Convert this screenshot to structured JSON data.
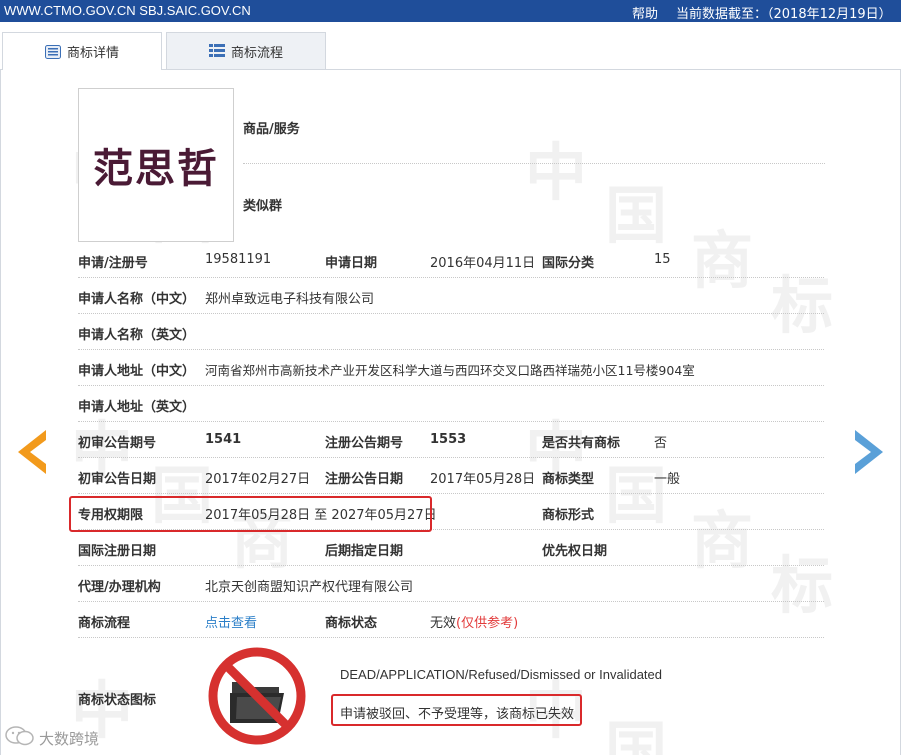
{
  "header": {
    "sites": "WWW.CTMO.GOV.CN SBJ.SAIC.GOV.CN",
    "help": "帮助",
    "data_date": "当前数据截至：（2018年12月19日）"
  },
  "tabs": [
    {
      "label": "商标详情",
      "icon": "list-detail-icon",
      "active": true
    },
    {
      "label": "商标流程",
      "icon": "list-grid-icon",
      "active": false
    }
  ],
  "watermark": {
    "chars": [
      "中",
      "国",
      "商",
      "标"
    ]
  },
  "trademark": {
    "image_text": "范思哲",
    "goods_services_label": "商品/服务",
    "similar_group_label": "类似群"
  },
  "fields": {
    "reg_no_label": "申请/注册号",
    "reg_no": "19581191",
    "app_date_label": "申请日期",
    "app_date": "2016年04月11日",
    "intl_class_label": "国际分类",
    "intl_class": "15",
    "applicant_cn_label": "申请人名称（中文）",
    "applicant_cn": "郑州卓致远电子科技有限公司",
    "applicant_en_label": "申请人名称（英文）",
    "applicant_en": "",
    "address_cn_label": "申请人地址（中文）",
    "address_cn": "河南省郑州市高新技术产业开发区科学大道与西四环交叉口路西祥瑞苑小区11号楼904室",
    "address_en_label": "申请人地址（英文）",
    "address_en": "",
    "prelim_issue_label": "初审公告期号",
    "prelim_issue": "1541",
    "reg_issue_label": "注册公告期号",
    "reg_issue": "1553",
    "shared_label": "是否共有商标",
    "shared": "否",
    "prelim_date_label": "初审公告日期",
    "prelim_date": "2017年02月27日",
    "reg_date_label": "注册公告日期",
    "reg_date": "2017年05月28日",
    "tm_type_label": "商标类型",
    "tm_type": "一般",
    "exclusive_label": "专用权期限",
    "exclusive": "2017年05月28日 至 2027年05月27日",
    "tm_form_label": "商标形式",
    "tm_form": "",
    "intl_reg_date_label": "国际注册日期",
    "intl_reg_date": "",
    "later_date_label": "后期指定日期",
    "later_date": "",
    "priority_date_label": "优先权日期",
    "priority_date": "",
    "agency_label": "代理/办理机构",
    "agency": "北京天创商盟知识产权代理有限公司",
    "process_label": "商标流程",
    "process_link": "点击查看",
    "status_label": "商标状态",
    "status": "无效",
    "status_note": "(仅供参考)",
    "status_icon_label": "商标状态图标"
  },
  "status_icon": {
    "icon": "no-folder-icon",
    "en": "DEAD/APPLICATION/Refused/Dismissed or Invalidated",
    "cn": "申请被驳回、不予受理等，该商标已失效"
  },
  "footer_watermark": "大数跨境",
  "colors": {
    "topbar": "#1f4e9a",
    "accent_red": "#d9292b",
    "link": "#2b7fc8",
    "arrow_left": "#f29a1c",
    "arrow_right": "#5aa0d8"
  }
}
